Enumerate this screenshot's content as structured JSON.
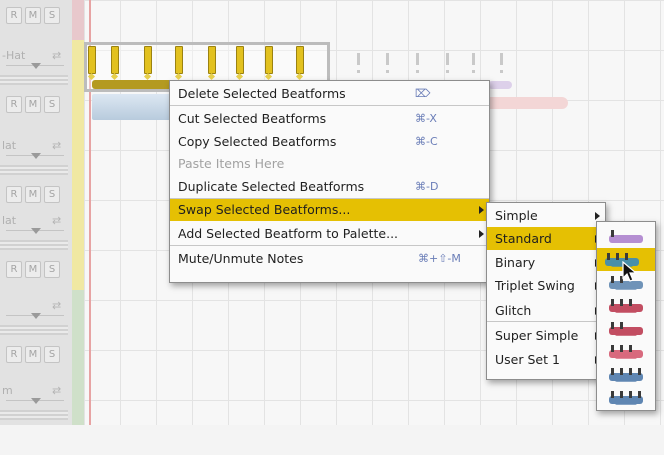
{
  "tracks": [
    {
      "name": "",
      "rms": [
        "R",
        "M",
        "S"
      ],
      "swap": "",
      "strip": "#e8c8cc"
    },
    {
      "name": "-Hat",
      "rms": [
        "R",
        "M",
        "S"
      ],
      "swap": "⇄",
      "strip": "#f0e8a2"
    },
    {
      "name": "lat",
      "rms": [
        "R",
        "M",
        "S"
      ],
      "swap": "⇄",
      "strip": "#f0e8a2"
    },
    {
      "name": "lat",
      "rms": [
        "R",
        "M",
        "S"
      ],
      "swap": "⇄",
      "strip": "#f0e8a2"
    },
    {
      "name": "",
      "rms": [
        "R",
        "M",
        "S"
      ],
      "swap": "⇄",
      "strip": "#cfe0c9"
    },
    {
      "name": "m",
      "rms": [],
      "swap": "⇄",
      "strip": "#cfe0c9"
    }
  ],
  "context_menu": {
    "items": [
      {
        "label": "Delete Selected Beatforms",
        "shortcut": "⌦",
        "enabled": true
      },
      {
        "label": "Cut Selected Beatforms",
        "shortcut": "⌘-X",
        "enabled": true
      },
      {
        "label": "Copy Selected Beatforms",
        "shortcut": "⌘-C",
        "enabled": true
      },
      {
        "label": "Paste Items Here",
        "shortcut": "",
        "enabled": false
      },
      {
        "label": "Duplicate Selected Beatforms",
        "shortcut": "⌘-D",
        "enabled": true
      },
      {
        "label": "Swap Selected Beatforms...",
        "shortcut": "",
        "enabled": true,
        "submenu": true,
        "highlighted": true
      },
      {
        "label": "Add Selected Beatform to Palette...",
        "shortcut": "",
        "enabled": true,
        "submenu": true
      },
      {
        "label": "Mute/Unmute Notes",
        "shortcut": "⌘+⇧-M",
        "enabled": true
      }
    ]
  },
  "swap_submenu": {
    "items": [
      {
        "label": "Simple",
        "submenu": true
      },
      {
        "label": "Standard",
        "submenu": true,
        "highlighted": true
      },
      {
        "label": "Binary",
        "submenu": true
      },
      {
        "label": "Triplet Swing",
        "submenu": true
      },
      {
        "label": "Glitch",
        "submenu": true
      },
      {
        "label": "Super Simple",
        "submenu": true
      },
      {
        "label": "User Set 1",
        "submenu": true
      }
    ]
  },
  "palette": {
    "items": [
      {
        "name": "beatform-violet",
        "color": "#b58fd2"
      },
      {
        "name": "beatform-teal",
        "color": "#4a8fa8",
        "highlighted": true
      },
      {
        "name": "beatform-blue",
        "color": "#6f93b8"
      },
      {
        "name": "beatform-red",
        "color": "#c24e62"
      },
      {
        "name": "beatform-red-2",
        "color": "#c24e62"
      },
      {
        "name": "beatform-pink",
        "color": "#d86a7e"
      },
      {
        "name": "beatform-blue-multi",
        "color": "#5f86b2"
      },
      {
        "name": "beatform-blue-multi-2",
        "color": "#5f86b2"
      }
    ]
  },
  "colors": {
    "accent": "#e5c003",
    "beatform": "#e2c11f"
  }
}
